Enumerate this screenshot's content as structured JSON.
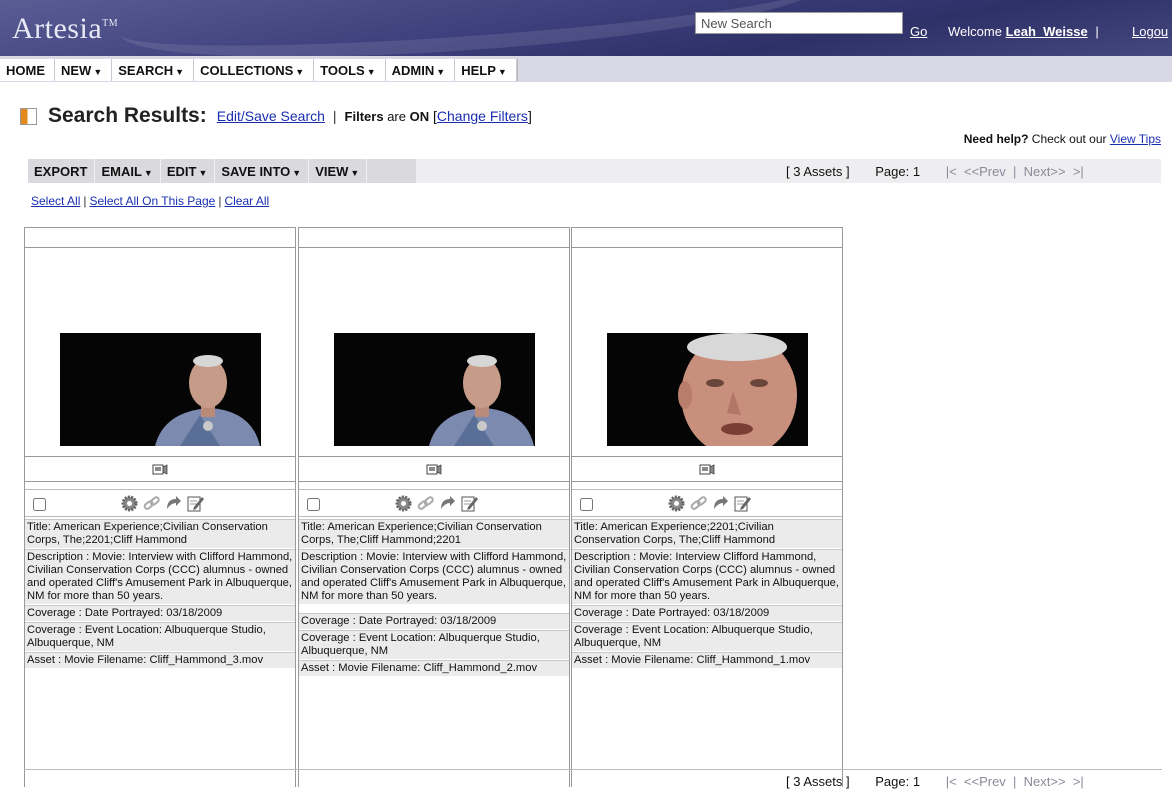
{
  "header": {
    "logo": "Artesia",
    "logo_tm": "TM",
    "search_placeholder": "New Search",
    "go_label": "Go",
    "welcome_label": "Welcome",
    "username": "Leah_Weisse",
    "divider": "|",
    "logout_label": "Logou"
  },
  "menu": {
    "items": [
      {
        "label": "HOME",
        "caret": false
      },
      {
        "label": "NEW",
        "caret": true
      },
      {
        "label": "SEARCH",
        "caret": true
      },
      {
        "label": "COLLECTIONS",
        "caret": true
      },
      {
        "label": "TOOLS",
        "caret": true
      },
      {
        "label": "ADMIN",
        "caret": true
      },
      {
        "label": "HELP",
        "caret": true
      }
    ]
  },
  "results": {
    "title": "Search Results:",
    "edit_link": "Edit/Save Search",
    "filters_label": "Filters",
    "filters_are": "are",
    "filters_state": "ON",
    "change_filters": "Change Filters",
    "help_prefix": "Need help?",
    "help_text": "Check out our",
    "help_link": "View Tips"
  },
  "toolbar": {
    "buttons": [
      {
        "label": "EXPORT",
        "caret": false
      },
      {
        "label": "EMAIL",
        "caret": true
      },
      {
        "label": "EDIT",
        "caret": true
      },
      {
        "label": "SAVE INTO",
        "caret": true
      },
      {
        "label": "VIEW",
        "caret": true
      }
    ]
  },
  "pager": {
    "assets_count": "[ 3  Assets ]",
    "page_label": "Page:",
    "page_number": "1",
    "first": "|<",
    "prev": "<<Prev",
    "next": "Next>>",
    "last": ">|",
    "bar": "|"
  },
  "selection": {
    "select_all": "Select All",
    "select_page": "Select All On This Page",
    "clear_all": "Clear All"
  },
  "assets": [
    {
      "title": "Title: American Experience;Civilian Conservation Corps, The;2201;Cliff Hammond",
      "description": "Description : Movie: Interview with Clifford Hammond, Civilian Conservation Corps (CCC) alumnus - owned and operated Cliff's Amusement Park in Albuquerque, NM for more than 50 years.",
      "date": "Coverage : Date Portrayed: 03/18/2009",
      "location": "Coverage : Event Location: Albuquerque Studio, Albuquerque, NM",
      "filename": "Asset : Movie Filename: Cliff_Hammond_3.mov"
    },
    {
      "title": "Title: American Experience;Civilian Conservation Corps, The;Cliff Hammond;2201",
      "description": "Description : Movie: Interview with Clifford Hammond, Civilian Conservation Corps (CCC) alumnus - owned and operated Cliff's Amusement Park in Albuquerque, NM for more than 50 years.",
      "date": "Coverage : Date Portrayed: 03/18/2009",
      "location": "Coverage : Event Location: Albuquerque Studio, Albuquerque, NM",
      "filename": "Asset : Movie Filename: Cliff_Hammond_2.mov"
    },
    {
      "title": "Title: American Experience;2201;Civilian Conservation Corps, The;Cliff Hammond",
      "description": "Description : Movie: Interview Clifford Hammond, Civilian Conservation Corps (CCC) alumnus - owned and operated Cliff's Amusement Park in Albuquerque, NM for more than 50 years.",
      "date": "Coverage : Date Portrayed: 03/18/2009",
      "location": "Coverage : Event Location: Albuquerque Studio, Albuquerque, NM",
      "filename": "Asset : Movie Filename: Cliff_Hammond_1.mov"
    }
  ],
  "icons": {
    "title_icon": "orange-square-icon",
    "camera": "video-camera-icon",
    "actions": [
      "gear-icon",
      "link-icon",
      "share-arrow-icon",
      "edit-note-icon"
    ]
  },
  "colors": {
    "link": "#1a2fb0",
    "header_bg": "#3d3f7c",
    "menubar_bg": "#d8d9e4",
    "accent_orange": "#e48a1c"
  }
}
